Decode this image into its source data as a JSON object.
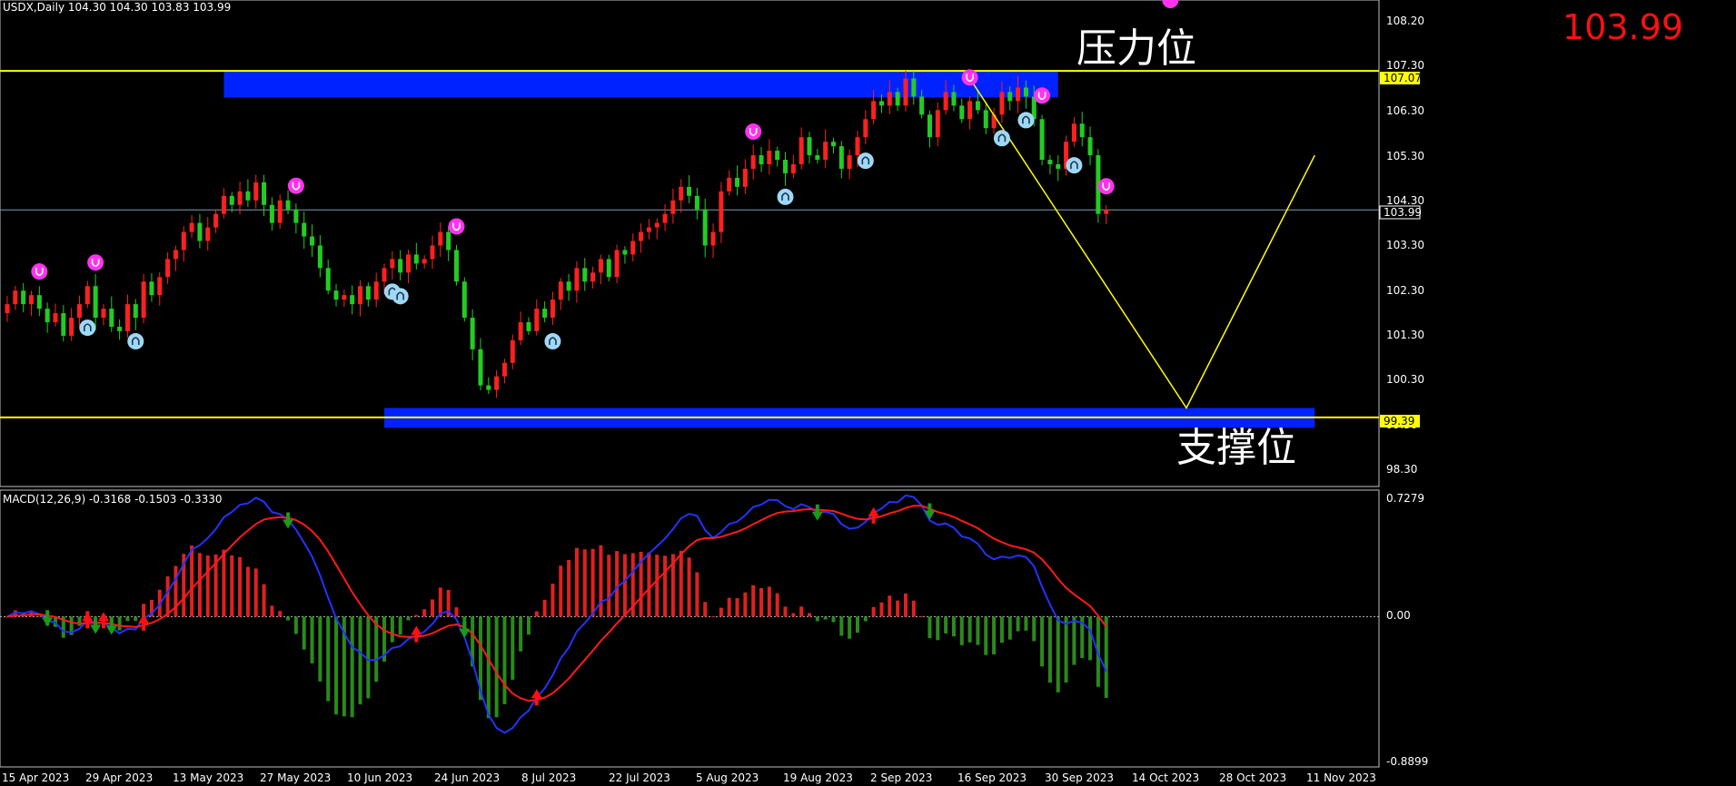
{
  "header": {
    "symbol_info": "USDX,Daily  104.30 104.30 103.83 103.99",
    "big_price": "103.99"
  },
  "macd_header": "MACD(12,26,9) -0.3168 -0.1503 -0.3330",
  "annotations": {
    "resistance": "压力位",
    "support": "支撑位"
  },
  "price_axis": {
    "ticks": [
      "108.20",
      "107.30",
      "106.30",
      "105.30",
      "104.30",
      "103.30",
      "102.30",
      "101.30",
      "100.30",
      "99.30",
      "98.30"
    ],
    "resistance_label": "107.07",
    "current_label": "103.99",
    "support_label": "99.39"
  },
  "macd_axis": {
    "ticks": [
      "0.7279",
      "0.00",
      "-0.8899"
    ]
  },
  "date_axis": [
    "15 Apr 2023",
    "29 Apr 2023",
    "13 May 2023",
    "27 May 2023",
    "10 Jun 2023",
    "24 Jun 2023",
    "8 Jul 2023",
    "22 Jul 2023",
    "5 Aug 2023",
    "19 Aug 2023",
    "2 Sep 2023",
    "16 Sep 2023",
    "30 Sep 2023",
    "14 Oct 2023",
    "28 Oct 2023",
    "11 Nov 2023"
  ],
  "colors": {
    "up": "#ff2020",
    "down": "#22cc22",
    "level": "#ffff00",
    "zone": "#0022ff",
    "macd": "#2233ff",
    "signal": "#ff1a1a",
    "hist_pos": "#e02020",
    "hist_neg": "#2a8a1a"
  },
  "chart_data": {
    "type": "candlestick",
    "symbol": "USDX",
    "timeframe": "Daily",
    "ylim": [
      97.9,
      108.6
    ],
    "levels": {
      "resistance": 107.07,
      "support": 99.39,
      "current": 103.99
    },
    "zones": [
      {
        "from_index": 27,
        "to_index": 131,
        "low": 106.48,
        "high": 107.05
      },
      {
        "from_index": 47,
        "to_index": 163,
        "low": 99.16,
        "high": 99.6
      }
    ],
    "projection": [
      {
        "index": 120,
        "value": 106.9
      },
      {
        "index": 147,
        "value": 99.6
      },
      {
        "index": 163,
        "value": 105.2
      }
    ],
    "closes": [
      101.9,
      102.2,
      101.9,
      102.1,
      101.8,
      101.5,
      101.7,
      101.2,
      101.6,
      101.9,
      102.3,
      101.6,
      101.8,
      101.4,
      101.3,
      101.9,
      101.6,
      102.4,
      102.1,
      102.5,
      102.9,
      103.1,
      103.5,
      103.7,
      103.3,
      103.6,
      103.9,
      104.3,
      104.1,
      104.4,
      104.2,
      104.6,
      104.1,
      103.7,
      104.2,
      104.0,
      103.7,
      103.4,
      103.2,
      102.7,
      102.2,
      102.0,
      102.1,
      101.9,
      102.3,
      102.0,
      102.4,
      102.7,
      102.9,
      102.6,
      103.0,
      102.8,
      102.9,
      103.2,
      103.5,
      103.1,
      102.4,
      101.6,
      100.9,
      100.1,
      100.0,
      100.3,
      100.6,
      101.1,
      101.5,
      101.3,
      101.8,
      101.6,
      102.0,
      102.4,
      102.2,
      102.7,
      102.4,
      102.6,
      102.9,
      102.5,
      103.1,
      103.0,
      103.3,
      103.5,
      103.6,
      103.7,
      103.9,
      104.2,
      104.5,
      104.3,
      104.0,
      103.2,
      103.5,
      104.4,
      104.7,
      104.5,
      104.9,
      105.2,
      105.0,
      105.3,
      105.1,
      104.8,
      105.0,
      105.6,
      105.2,
      105.1,
      105.5,
      105.4,
      104.9,
      105.2,
      105.6,
      106.0,
      106.4,
      106.3,
      106.6,
      106.3,
      106.9,
      106.5,
      106.1,
      105.6,
      106.2,
      106.6,
      106.3,
      106.0,
      106.4,
      106.2,
      105.8,
      106.1,
      106.6,
      106.4,
      106.7,
      106.5,
      106.0,
      105.1,
      105.0,
      104.9,
      105.5,
      105.9,
      105.6,
      105.2,
      103.9,
      103.99
    ],
    "macd": {
      "zero_value": 0.0,
      "ylim": [
        -0.8899,
        0.7279
      ],
      "last": {
        "macd": -0.3168,
        "signal": -0.1503,
        "histogram": -0.333
      },
      "histogram_note": "positive bars red, negative bars green"
    },
    "signals": {
      "buy_markers_index": [
        10,
        16,
        48,
        49,
        68,
        97,
        107,
        124,
        127,
        133
      ],
      "sell_markers_index": [
        4,
        11,
        36,
        56,
        93,
        120,
        129,
        137,
        145
      ]
    },
    "xlabels": [
      "15 Apr 2023",
      "29 Apr 2023",
      "13 May 2023",
      "27 May 2023",
      "10 Jun 2023",
      "24 Jun 2023",
      "8 Jul 2023",
      "22 Jul 2023",
      "5 Aug 2023",
      "19 Aug 2023",
      "2 Sep 2023",
      "16 Sep 2023",
      "30 Sep 2023",
      "14 Oct 2023",
      "28 Oct 2023",
      "11 Nov 2023"
    ]
  }
}
